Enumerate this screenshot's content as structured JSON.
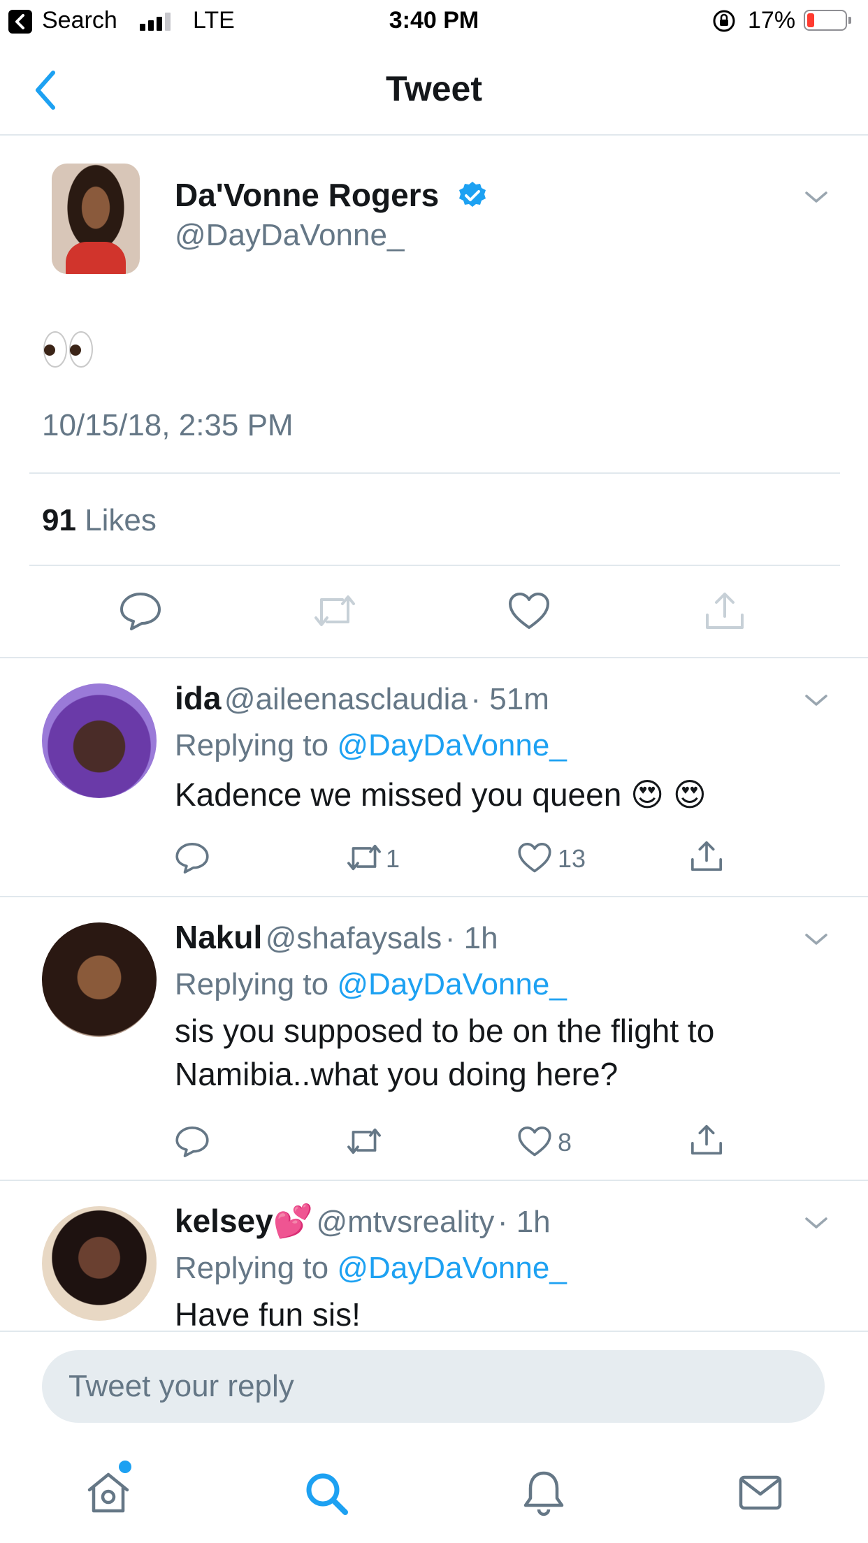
{
  "status_bar": {
    "back_app": "Search",
    "network": "LTE",
    "time": "3:40 PM",
    "battery_pct": "17%"
  },
  "nav": {
    "title": "Tweet"
  },
  "tweet": {
    "author_name": "Da'Vonne Rogers",
    "author_handle": "@DayDaVonne_",
    "text": "👀",
    "date": "10/15/18, 2:35 PM",
    "likes_count": "91",
    "likes_label": "Likes"
  },
  "replies": [
    {
      "name": "ida",
      "handle": "@aileenasclaudia",
      "time": "· 51m",
      "replying_prefix": "Replying to",
      "replying_to": "@DayDaVonne_",
      "text": "Kadence we missed you queen 😍 😍",
      "retweets": "1",
      "likes": "13"
    },
    {
      "name": "Nakul",
      "handle": "@shafaysals",
      "time": "· 1h",
      "replying_prefix": "Replying to",
      "replying_to": "@DayDaVonne_",
      "text_line1": "sis you supposed to be on the flight to",
      "text_line2": "Namibia..what you doing here?",
      "retweets": "",
      "likes": "8"
    },
    {
      "name": "kelsey💕",
      "handle": "@mtvsreality",
      "time": "· 1h",
      "replying_prefix": "Replying to",
      "replying_to": "@DayDaVonne_",
      "text": "Have fun sis!"
    }
  ],
  "reply_box": {
    "placeholder": "Tweet your reply"
  },
  "tabs": [
    "home",
    "search",
    "notifications",
    "messages"
  ],
  "colors": {
    "accent": "#1da1f2",
    "secondary_text": "#657786",
    "divider": "#e1e8ed"
  },
  "icons": [
    "back-chevron-icon",
    "verified-badge-icon",
    "chevron-down-icon",
    "reply-icon",
    "retweet-icon",
    "like-icon",
    "share-icon",
    "home-icon",
    "search-icon",
    "bell-icon",
    "mail-icon"
  ]
}
